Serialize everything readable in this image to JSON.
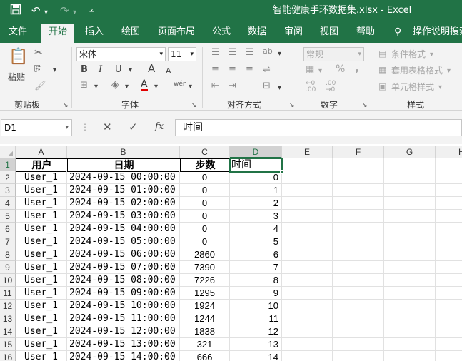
{
  "window": {
    "title": "智能健康手环数据集.xlsx  -  Excel",
    "brand_color": "#217346"
  },
  "quick_access": {
    "save_icon": "save-icon",
    "undo_icon": "undo-icon",
    "redo_icon": "redo-icon",
    "customize_icon": "customize-icon"
  },
  "tabs": [
    "文件",
    "开始",
    "插入",
    "绘图",
    "页面布局",
    "公式",
    "数据",
    "审阅",
    "视图",
    "帮助",
    "操作说明搜索"
  ],
  "active_tab": "开始",
  "ribbon": {
    "clipboard": {
      "paste": "粘贴",
      "label": "剪贴板"
    },
    "font": {
      "name": "宋体",
      "size": "11",
      "bold": "B",
      "italic": "I",
      "underline": "U",
      "grow": "A",
      "shrink": "A",
      "wen": "wén",
      "label": "字体"
    },
    "alignment": {
      "label": "对齐方式"
    },
    "number": {
      "format": "常规",
      "percent": "%",
      "comma": ",",
      "label": "数字"
    },
    "styles": {
      "conditional": "条件格式",
      "table": "套用表格格式",
      "cell": "单元格样式",
      "label": "样式"
    }
  },
  "formula_bar": {
    "name_box": "D1",
    "cancel": "✕",
    "enter": "✓",
    "fx": "fx",
    "content": "时间"
  },
  "columns": [
    "A",
    "B",
    "C",
    "D",
    "E",
    "F",
    "G",
    "H"
  ],
  "selected_cell": "D1",
  "headers": [
    "用户",
    "日期",
    "步数",
    "时间"
  ],
  "rows": [
    [
      "User_1",
      "2024-09-15 00:00:00",
      "0",
      "0"
    ],
    [
      "User_1",
      "2024-09-15 01:00:00",
      "0",
      "1"
    ],
    [
      "User_1",
      "2024-09-15 02:00:00",
      "0",
      "2"
    ],
    [
      "User_1",
      "2024-09-15 03:00:00",
      "0",
      "3"
    ],
    [
      "User_1",
      "2024-09-15 04:00:00",
      "0",
      "4"
    ],
    [
      "User_1",
      "2024-09-15 05:00:00",
      "0",
      "5"
    ],
    [
      "User_1",
      "2024-09-15 06:00:00",
      "2860",
      "6"
    ],
    [
      "User_1",
      "2024-09-15 07:00:00",
      "7390",
      "7"
    ],
    [
      "User_1",
      "2024-09-15 08:00:00",
      "7226",
      "8"
    ],
    [
      "User_1",
      "2024-09-15 09:00:00",
      "1295",
      "9"
    ],
    [
      "User_1",
      "2024-09-15 10:00:00",
      "1924",
      "10"
    ],
    [
      "User_1",
      "2024-09-15 11:00:00",
      "1244",
      "11"
    ],
    [
      "User_1",
      "2024-09-15 12:00:00",
      "1838",
      "12"
    ],
    [
      "User_1",
      "2024-09-15 13:00:00",
      "321",
      "13"
    ],
    [
      "User_1",
      "2024-09-15 14:00:00",
      "666",
      "14"
    ]
  ]
}
